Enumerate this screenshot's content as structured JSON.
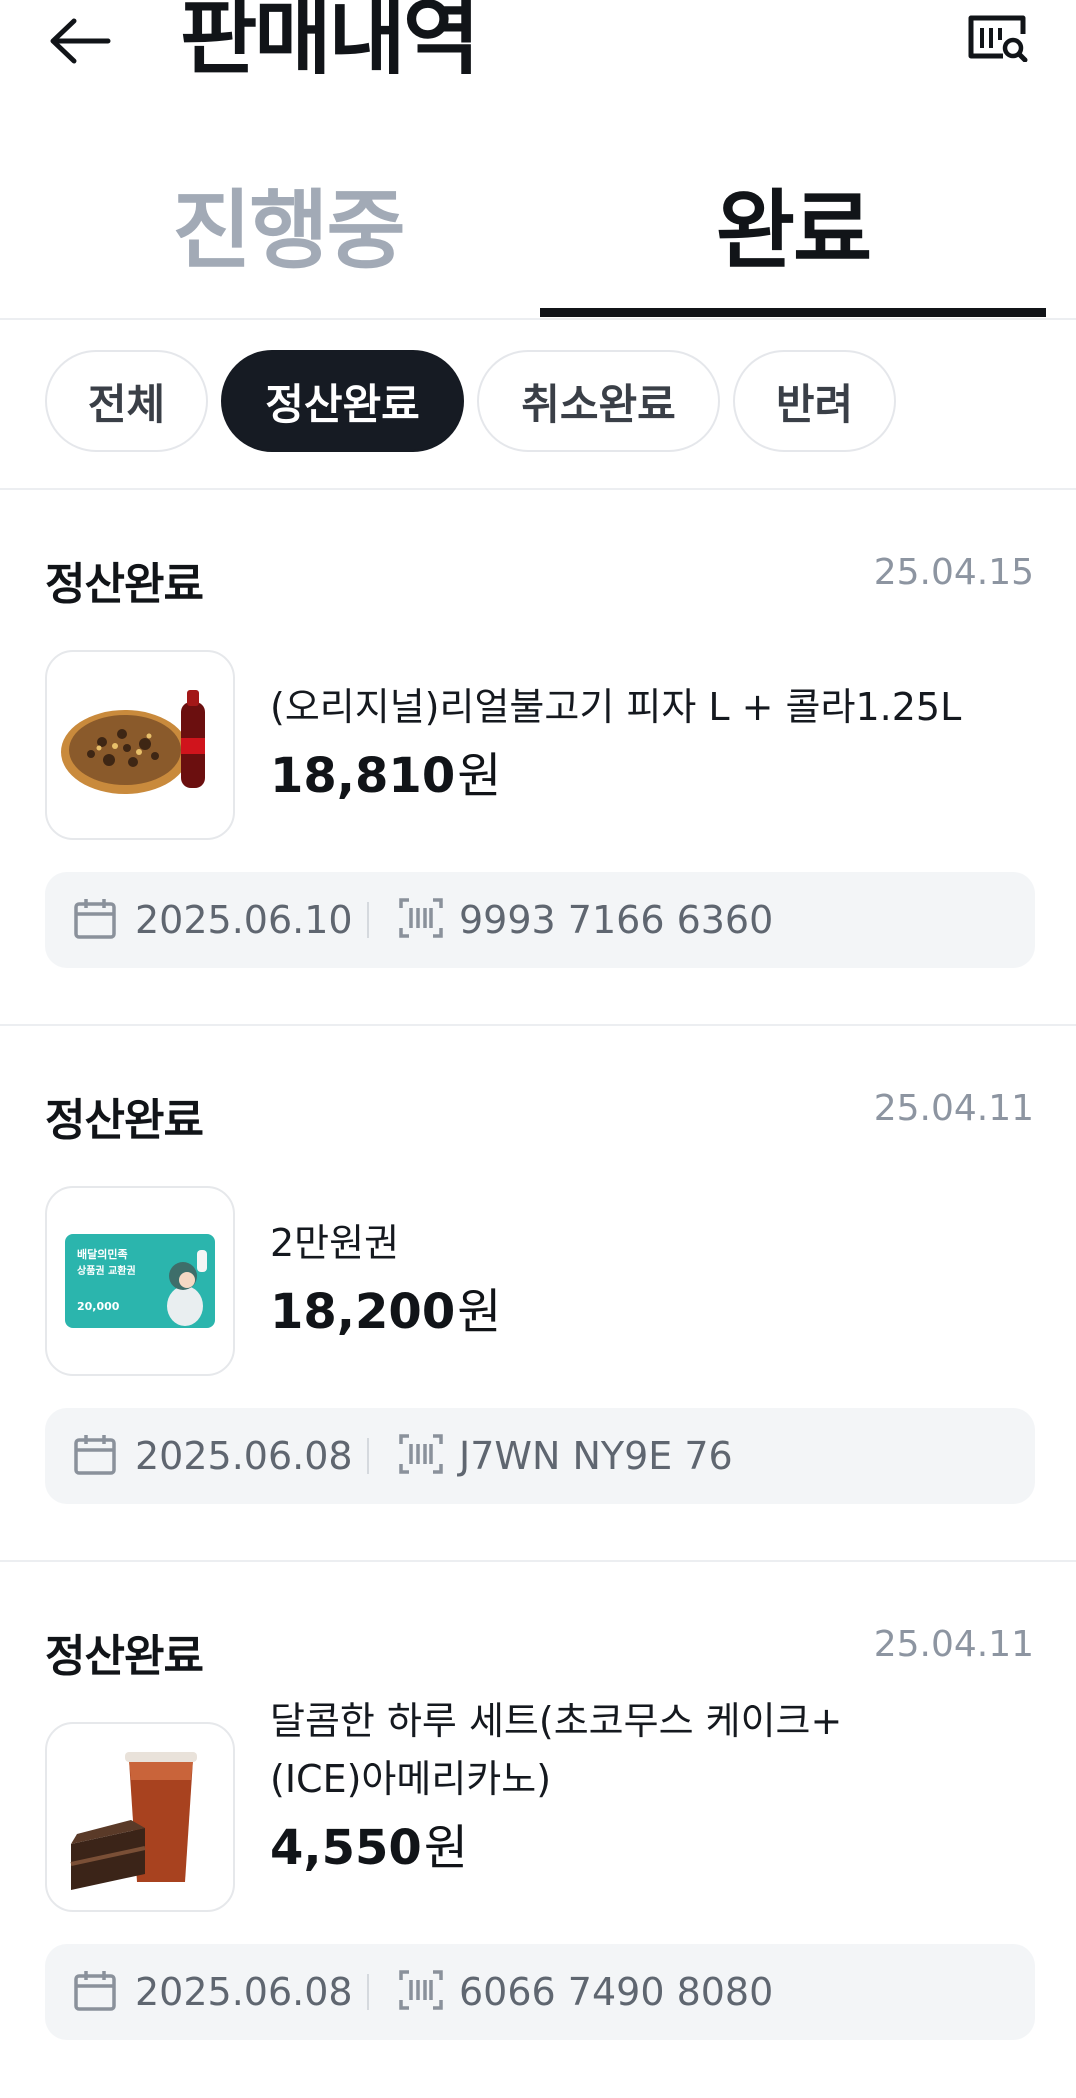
{
  "header": {
    "title": "판매내역",
    "back_icon": "arrow-left-icon",
    "search_icon": "receipt-search-icon"
  },
  "tabs": [
    {
      "label": "진행중",
      "active": false
    },
    {
      "label": "완료",
      "active": true
    }
  ],
  "filters": [
    {
      "label": "전체",
      "active": false
    },
    {
      "label": "정산완료",
      "active": true
    },
    {
      "label": "취소완료",
      "active": false
    },
    {
      "label": "반려",
      "active": false
    }
  ],
  "orders": [
    {
      "status": "정산완료",
      "date": "25.04.15",
      "name": "(오리지널)리얼불고기 피자 L + 콜라1.25L",
      "price": "18,810",
      "unit": "원",
      "use_date": "2025.06.10",
      "code": "9993 7166 6360"
    },
    {
      "status": "정산완료",
      "date": "25.04.11",
      "name": "2만원권",
      "price": "18,200",
      "unit": "원",
      "use_date": "2025.06.08",
      "code": "J7WN NY9E 76"
    },
    {
      "status": "정산완료",
      "date": "25.04.11",
      "name": "달콤한 하루 세트(초코무스 케이크+(ICE)아메리카노)",
      "price": "4,550",
      "unit": "원",
      "use_date": "2025.06.08",
      "code": "6066 7490 8080"
    }
  ],
  "voucher": {
    "brand": "배달의민족",
    "line": "상품권 교환권",
    "amount": "20,000"
  },
  "colors": {
    "primary": "#161b23",
    "muted": "#a2aab6",
    "surface": "#f3f5f7"
  }
}
